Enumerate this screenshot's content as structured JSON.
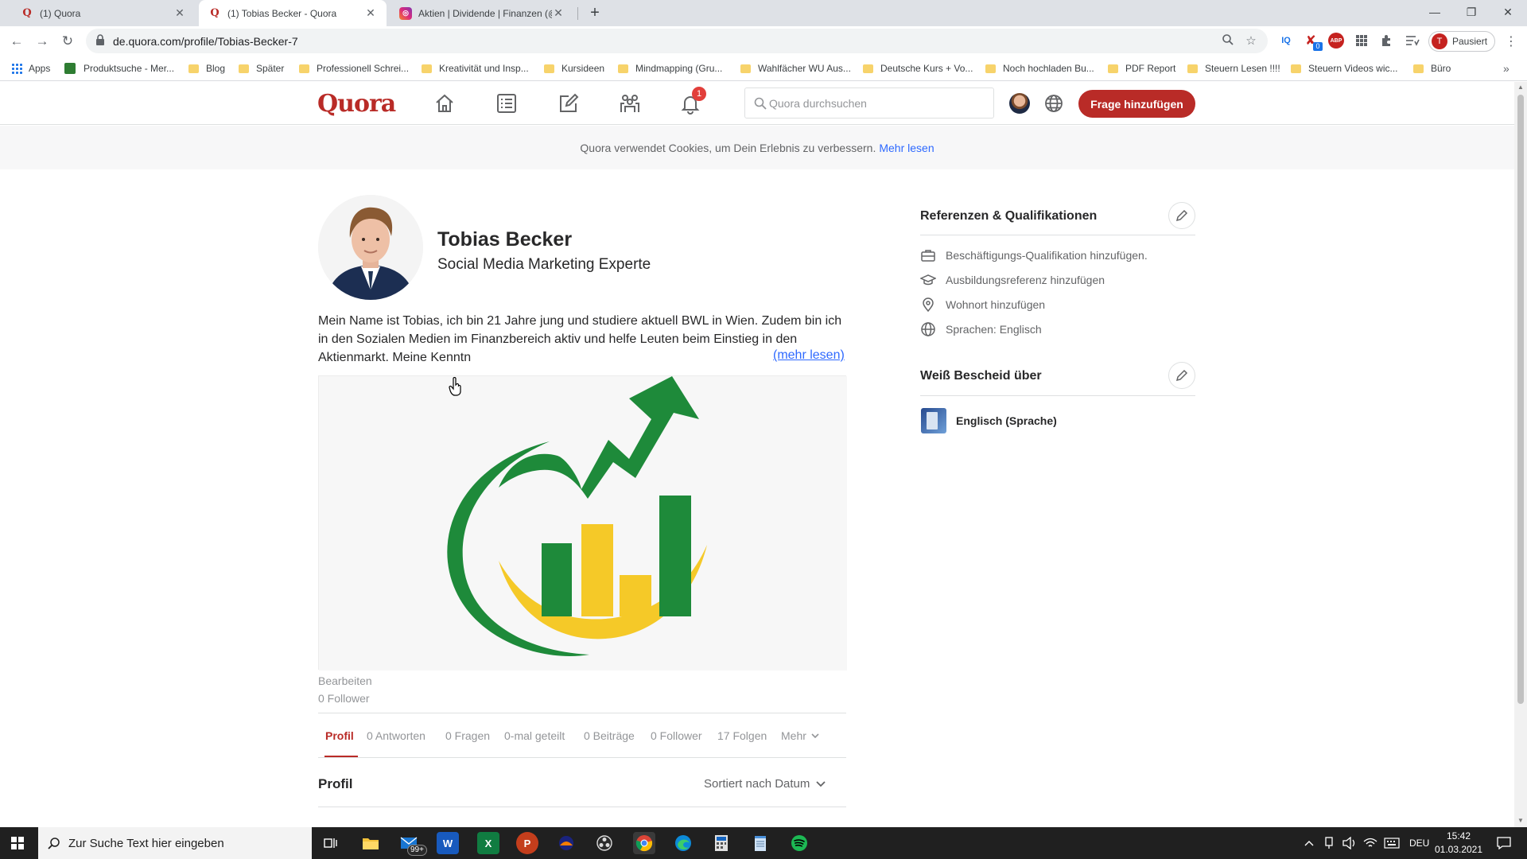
{
  "browser": {
    "tabs": [
      {
        "label": "(1) Quora",
        "favicon": "quora-icon"
      },
      {
        "label": "(1) Tobias Becker - Quora",
        "favicon": "quora-icon",
        "active": true
      },
      {
        "label": "Aktien | Dividende | Finanzen (@",
        "favicon": "instagram-icon"
      }
    ],
    "url": "de.quora.com/profile/Tobias-Becker-7",
    "profile_initial": "T",
    "profile_status": "Pausiert",
    "ext_badge": "0",
    "ext_iq": "IQ",
    "ext_abp": "ABP",
    "bookmarks": [
      "Apps",
      "Produktsuche - Mer...",
      "Blog",
      "Später",
      "Professionell Schrei...",
      "Kreativität und Insp...",
      "Kursideen",
      "Mindmapping (Gru...",
      "Wahlfächer WU Aus...",
      "Deutsche Kurs + Vo...",
      "Noch hochladen Bu...",
      "PDF Report",
      "Steuern Lesen !!!!",
      "Steuern Videos wic...",
      "Büro"
    ]
  },
  "quora": {
    "logo": "Quora",
    "notification_count": "1",
    "search_placeholder": "Quora durchsuchen",
    "ask_button": "Frage hinzufügen",
    "cookie_text": "Quora verwendet Cookies, um Dein Erlebnis zu verbessern.",
    "cookie_link": "Mehr lesen",
    "accent_color": "#b92b27"
  },
  "profile": {
    "name": "Tobias Becker",
    "headline": "Social Media Marketing Experte",
    "bio": "Mein Name ist Tobias, ich bin 21 Jahre jung und studiere aktuell BWL in Wien. Zudem bin ich in den Sozialen Medien im Finanzbereich aktiv und helfe Leuten beim Einstieg in den Aktienmarkt. Meine Kenntn",
    "more_link": "(mehr lesen)",
    "edit_label": "Bearbeiten",
    "followers": "0 Follower",
    "tabs": [
      "Profil",
      "0 Antworten",
      "0 Fragen",
      "0-mal geteilt",
      "0 Beiträge",
      "0 Follower",
      "17 Folgen",
      "Mehr"
    ],
    "section_title": "Profil",
    "sort_label": "Sortiert nach Datum"
  },
  "sidebar": {
    "credentials_title": "Referenzen & Qualifikationen",
    "credentials": [
      {
        "icon": "briefcase-icon",
        "label": "Beschäftigungs-Qualifikation hinzufügen."
      },
      {
        "icon": "graduation-cap-icon",
        "label": "Ausbildungsreferenz hinzufügen"
      },
      {
        "icon": "location-pin-icon",
        "label": "Wohnort hinzufügen"
      },
      {
        "icon": "globe-icon",
        "label": "Sprachen: Englisch"
      }
    ],
    "knows_title": "Weiß Bescheid über",
    "topics": [
      {
        "label": "Englisch (Sprache)"
      }
    ]
  },
  "taskbar": {
    "search_placeholder": "Zur Suche Text hier eingeben",
    "mail_badge": "99+",
    "language": "DEU",
    "time": "15:42",
    "date": "01.03.2021"
  }
}
